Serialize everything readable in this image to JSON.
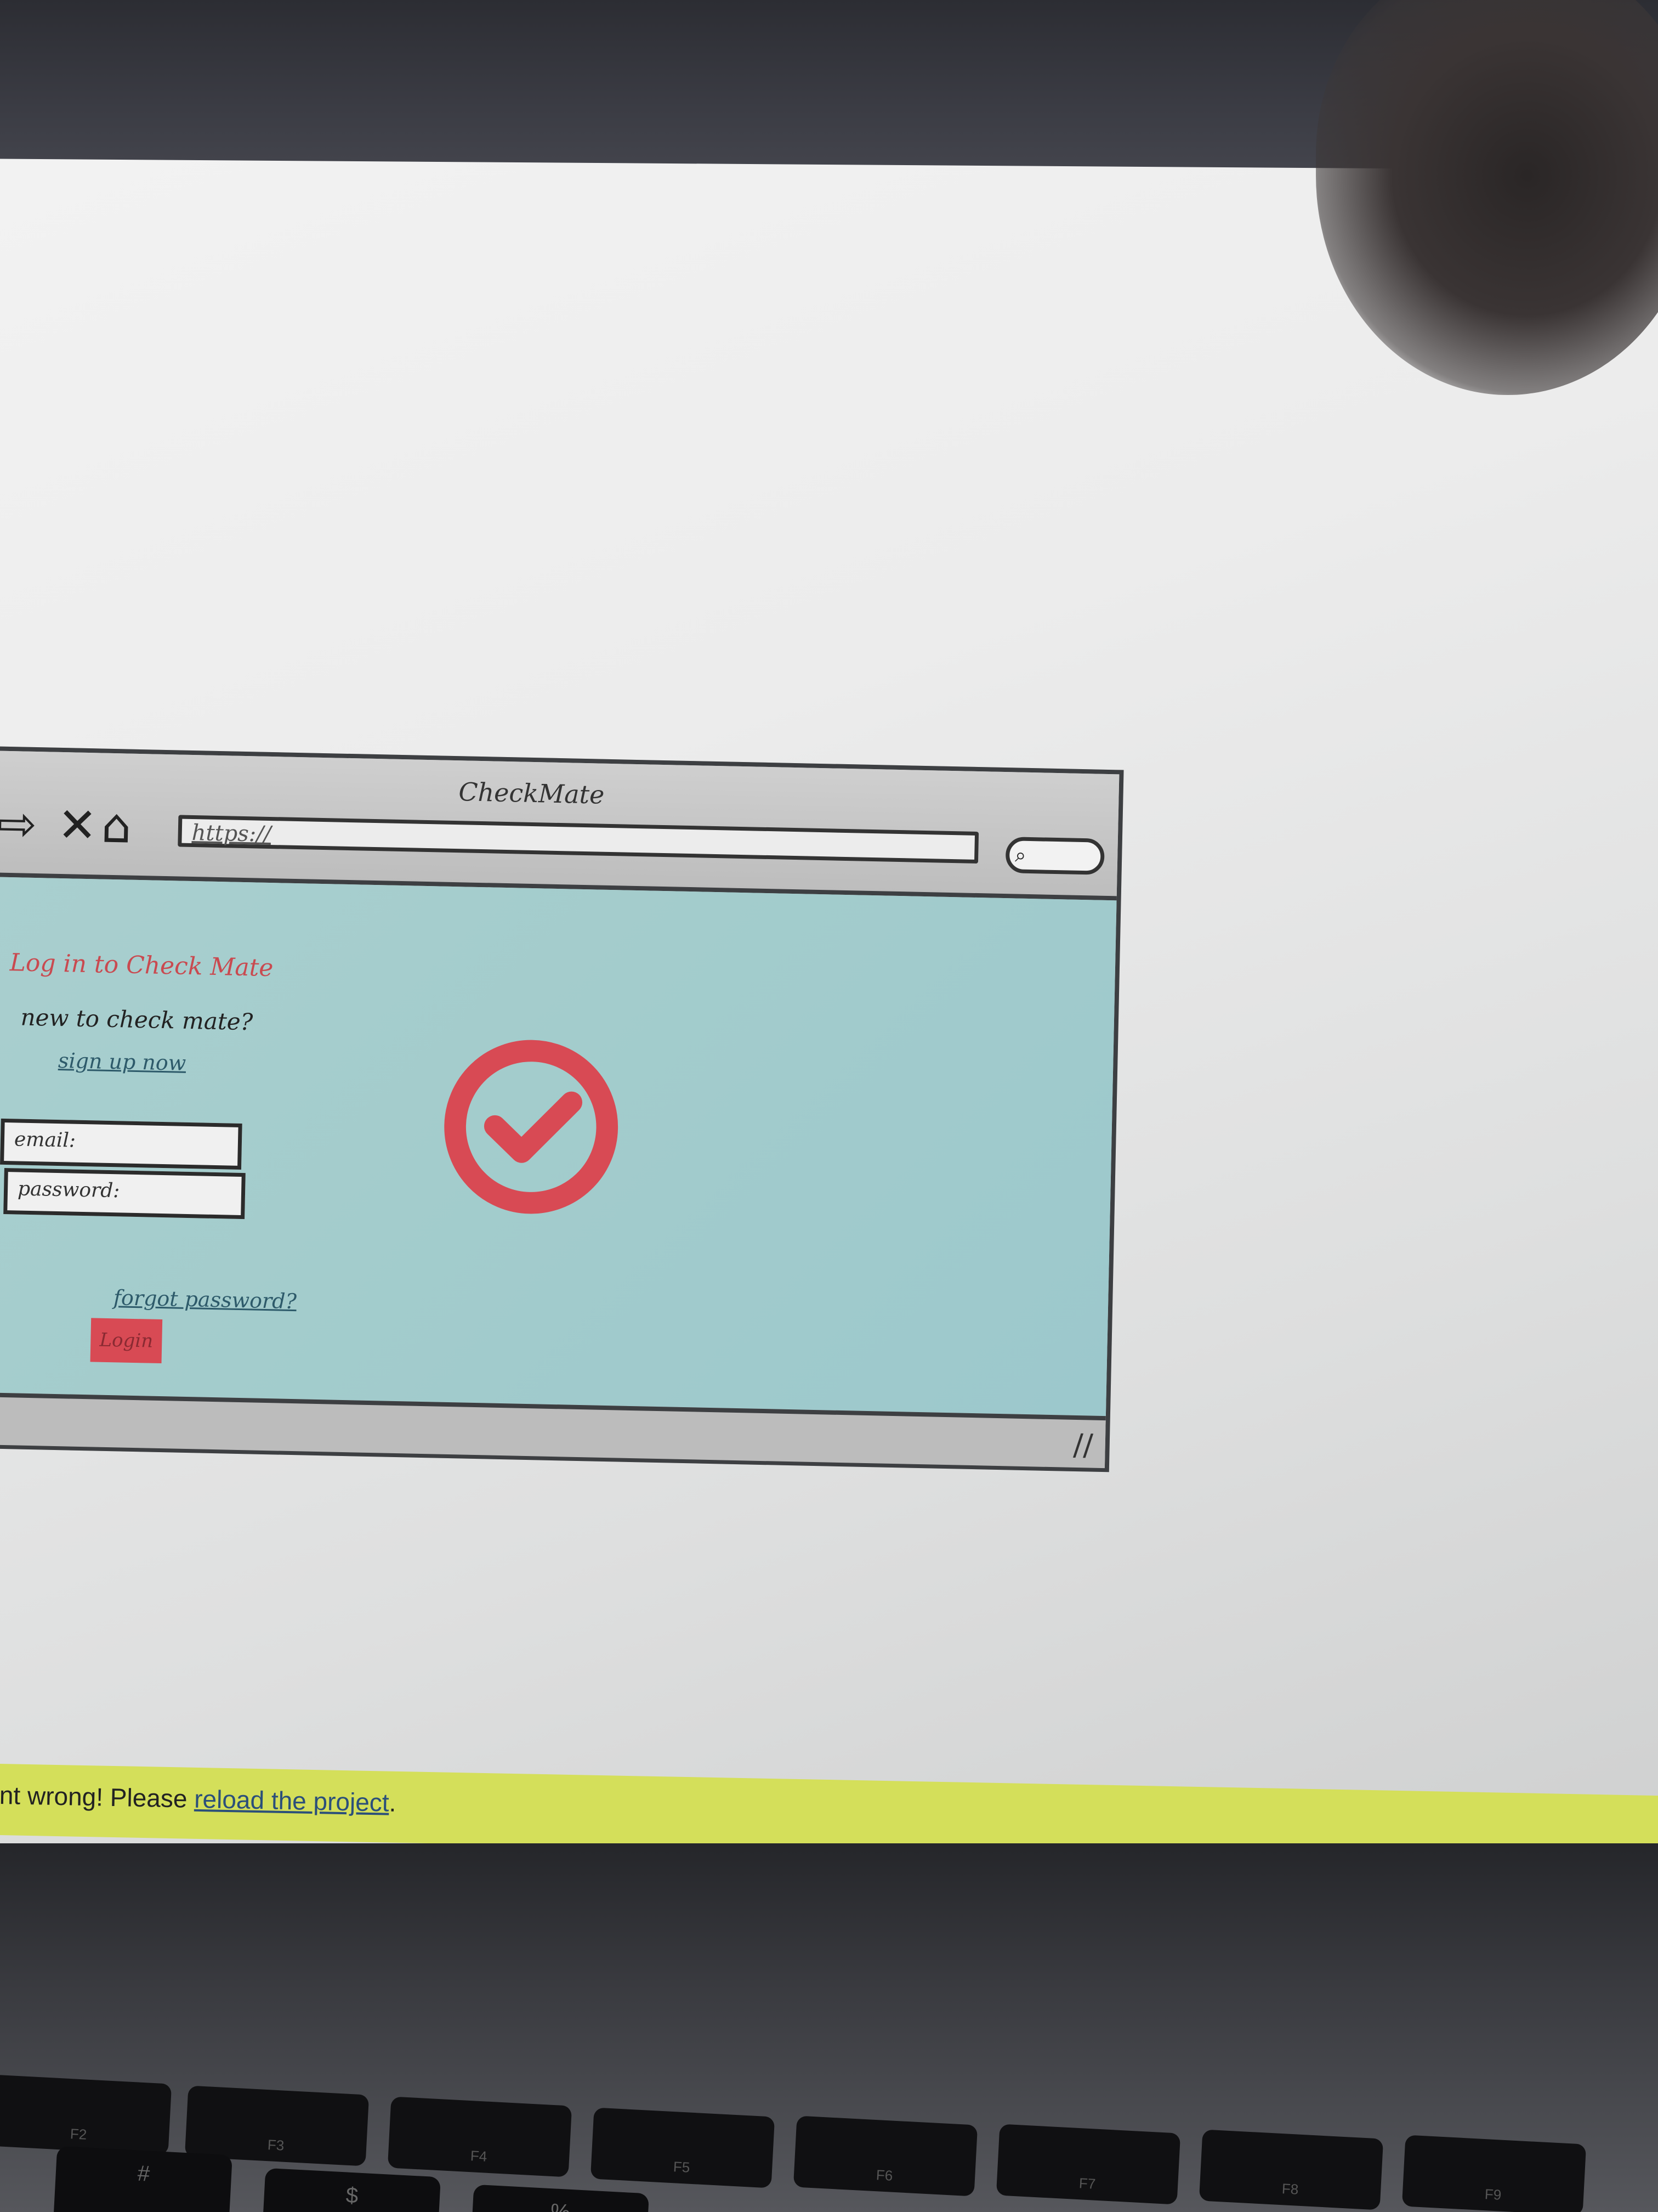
{
  "wireframe": {
    "window_title": "CheckMate",
    "url_text": "https://",
    "nav": {
      "forward_glyph": "⇨",
      "close_glyph": "✕",
      "home_glyph": "⌂"
    },
    "search_glyph": "⌕",
    "resize_glyph": "//",
    "login": {
      "title": "Log in to Check Mate",
      "new_to": "new to check mate?",
      "signup_link": "sign up now",
      "email_placeholder": "email:",
      "password_placeholder": "password:",
      "forgot_link": "forgot password?",
      "login_button": "Login"
    },
    "colors": {
      "accent_red": "#d84a54",
      "body_teal": "#a3cccc"
    }
  },
  "banner": {
    "text": "nt wrong! Please ",
    "link": "reload the project",
    "suffix": "."
  },
  "keyboard": {
    "fn_keys": [
      "F2",
      "F3",
      "F4",
      "F5",
      "F6",
      "F7",
      "F8",
      "F9"
    ],
    "row2": [
      "#",
      "$",
      "%"
    ]
  }
}
